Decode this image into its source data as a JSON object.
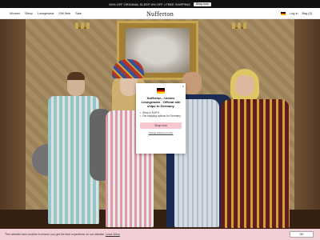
{
  "announcement": {
    "text": "50% OFF ORIGINAL SLEEP 5% OFF • FREE SHIPPING",
    "cta": "Shop now"
  },
  "header": {
    "nav": [
      "Women",
      "Sleep",
      "Loungewear",
      "Gift Sets",
      "Sale"
    ],
    "logo": "Nufferton",
    "login": "Log in",
    "bag": "Bag (0)",
    "country_flag": "german-flag-icon"
  },
  "popup": {
    "title": "Nufferton - Unisex Loungewear - Official site ships to Germany",
    "bullets": [
      "Shop in EUR €",
      "Get shipping options for Germany"
    ],
    "button": "Shop now",
    "link": "Change shipping country",
    "close": "×",
    "flag": "german-flag-icon"
  },
  "cookie": {
    "text": "This website uses cookies to ensure you get the best experience on our website.",
    "learn_more": "Learn More",
    "ok": "OK"
  },
  "colors": {
    "accent_pink": "#f7c6cf",
    "cookie_bar": "#f2cfd5",
    "announce_bg": "#111111"
  }
}
